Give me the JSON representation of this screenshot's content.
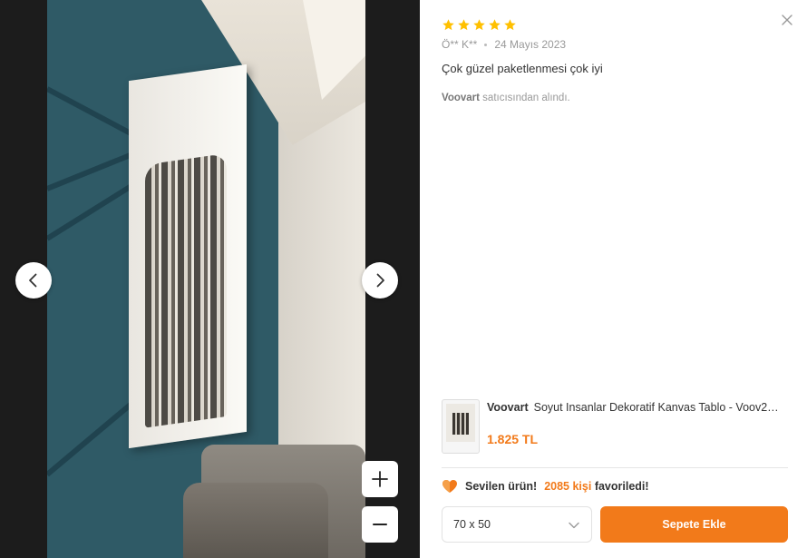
{
  "viewer": {
    "image_alt": "Kanvas tablo duvar fotoğrafı",
    "prev_icon": "chevron-left-icon",
    "next_icon": "chevron-right-icon",
    "zoom_in_icon": "plus-icon",
    "zoom_out_icon": "minus-icon"
  },
  "review": {
    "rating": 5,
    "max_rating": 5,
    "author": "Ö** K**",
    "date": "24 Mayıs 2023",
    "text": "Çok güzel paketlenmesi çok iyi",
    "seller_name": "Voovart",
    "seller_suffix": "satıcısından alındı."
  },
  "product": {
    "brand": "Voovart",
    "name": "Soyut Insanlar Dekoratif Kanvas Tablo - Voov2…",
    "price": "1.825 TL"
  },
  "favorites": {
    "prefix": "Sevilen ürün!",
    "count": "2085 kişi",
    "suffix": "favoriledi!"
  },
  "actions": {
    "size_selected": "70 x 50",
    "add_to_cart": "Sepete Ekle"
  },
  "colors": {
    "accent": "#f27a1a",
    "star": "#ffc000",
    "viewer_bg": "#1c1c1c"
  }
}
